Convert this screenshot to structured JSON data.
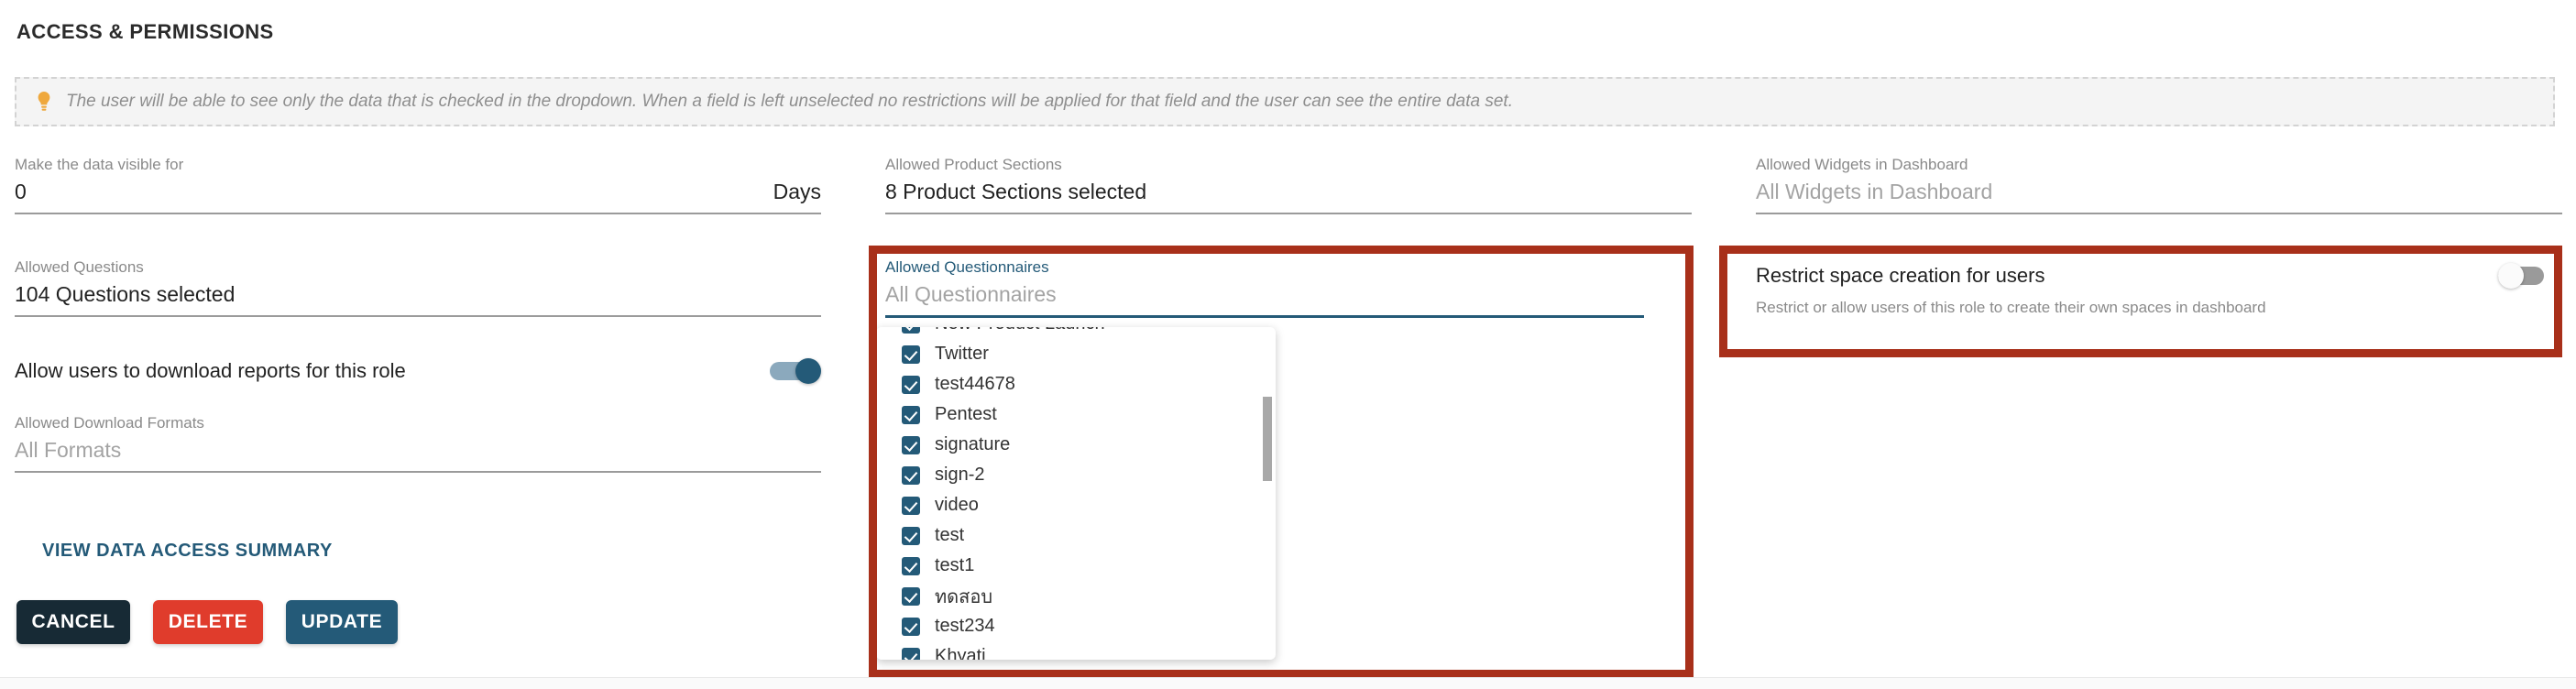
{
  "section": {
    "title": "ACCESS & PERMISSIONS"
  },
  "info_banner": {
    "icon": "lightbulb-icon",
    "text": "The user will be able to see only the data that is checked in the dropdown. When a field is left unselected no restrictions will be applied for that field and the user can see the entire data set."
  },
  "colors": {
    "accent": "#245a78",
    "highlight_border": "#a8301a",
    "delete": "#e03c2c",
    "cancel": "#172a35",
    "bulb": "#efa83c"
  },
  "fields": {
    "data_visible_for": {
      "label": "Make the data visible for",
      "value": "0",
      "suffix": "Days"
    },
    "allowed_questions": {
      "label": "Allowed Questions",
      "value": "104 Questions selected"
    },
    "allowed_product_sections": {
      "label": "Allowed Product Sections",
      "value": "8 Product Sections selected"
    },
    "allowed_questionnaires": {
      "label": "Allowed Questionnaires",
      "placeholder": "All Questionnaires",
      "value": "All Questionnaires"
    },
    "allowed_widgets": {
      "label": "Allowed Widgets in Dashboard",
      "placeholder": "All Widgets in Dashboard",
      "value": "All Widgets in Dashboard"
    },
    "allowed_download_formats": {
      "label": "Allowed Download Formats",
      "placeholder": "All Formats",
      "value": "All Formats"
    }
  },
  "toggles": {
    "download_reports": {
      "label": "Allow users to download reports for this role",
      "state": "on"
    },
    "restrict_space_creation": {
      "label": "Restrict space creation for users",
      "description": "Restrict or allow users of this role to create their own spaces in dashboard",
      "state": "off"
    }
  },
  "links": {
    "view_data_access_summary": "VIEW DATA ACCESS SUMMARY"
  },
  "buttons": {
    "cancel": "CANCEL",
    "delete": "DELETE",
    "update": "UPDATE"
  },
  "questionnaire_dropdown": {
    "items": [
      {
        "label": "New Product Launch",
        "checked": true
      },
      {
        "label": "Twitter",
        "checked": true
      },
      {
        "label": "test44678",
        "checked": true
      },
      {
        "label": "Pentest",
        "checked": true
      },
      {
        "label": "signature",
        "checked": true
      },
      {
        "label": "sign-2",
        "checked": true
      },
      {
        "label": "video",
        "checked": true
      },
      {
        "label": "test",
        "checked": true
      },
      {
        "label": "test1",
        "checked": true
      },
      {
        "label": "ทดสอบ",
        "checked": true
      },
      {
        "label": "test234",
        "checked": true
      },
      {
        "label": "Khyati",
        "checked": true
      }
    ]
  }
}
